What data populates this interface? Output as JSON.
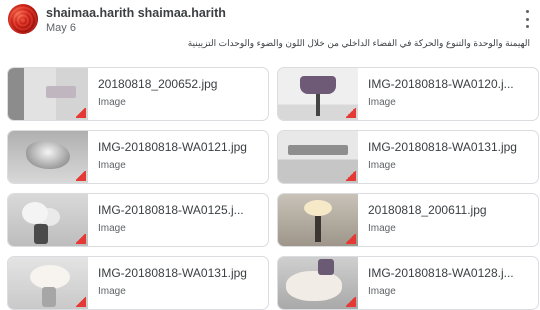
{
  "post": {
    "author": "shaimaa.harith shaimaa.harith",
    "date": "May 6",
    "text": "الهيمنة والوحدة والتنوع والحركة في الفضاء الداخلي من خلال اللون والضوء والوحدات التزيينية"
  },
  "attachments": [
    {
      "name": "20180818_200652.jpg",
      "type": "Image"
    },
    {
      "name": "IMG-20180818-WA0120.j...",
      "type": "Image"
    },
    {
      "name": "IMG-20180818-WA0121.jpg",
      "type": "Image"
    },
    {
      "name": "IMG-20180818-WA0131.jpg",
      "type": "Image"
    },
    {
      "name": "IMG-20180818-WA0125.j...",
      "type": "Image"
    },
    {
      "name": "20180818_200611.jpg",
      "type": "Image"
    },
    {
      "name": "IMG-20180818-WA0131.jpg",
      "type": "Image"
    },
    {
      "name": "IMG-20180818-WA0128.j...",
      "type": "Image"
    }
  ],
  "icons": {
    "avatar": "profile-avatar",
    "more": "more-vert-icon",
    "file_badge": "image-file-icon"
  },
  "colors": {
    "badge": "#e53935",
    "border": "#dadce0",
    "text": "#3c4043",
    "secondary_text": "#5f6368"
  }
}
